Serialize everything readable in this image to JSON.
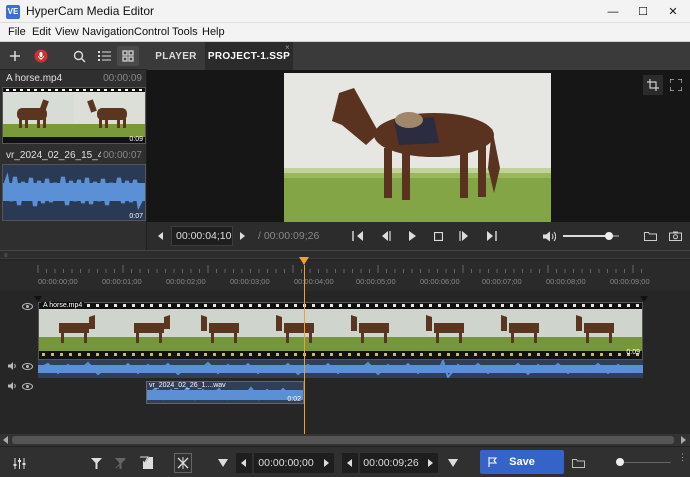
{
  "window": {
    "icon_text": "VE",
    "title": "HyperCam Media Editor",
    "minimize_glyph": "—",
    "maximize_glyph": "☐",
    "close_glyph": "✕"
  },
  "menu": [
    "File",
    "Edit",
    "View",
    "Navigation",
    "Control",
    "Tools",
    "Help"
  ],
  "tabs": [
    {
      "label": "PLAYER",
      "active": false
    },
    {
      "label": "PROJECT-1.SSP",
      "active": true
    }
  ],
  "media_list": [
    {
      "name": "A horse.mp4",
      "duration": "00:00:09",
      "thumb_duration": "0:09"
    },
    {
      "name": "vr_2024_02_26_15_45...",
      "duration": "00:00:07",
      "thumb_duration": "0:07"
    }
  ],
  "player": {
    "current_time": "00:00:04;10",
    "total_time": "/ 00:00:09;26",
    "volume_level": 0.83
  },
  "timeline": {
    "ruler_labels": [
      "00:00:00;00",
      "00:00:01;00",
      "00:00:02;00",
      "00:00:03;00",
      "00:00:04;00",
      "00:00:05;00",
      "00:00:06;00",
      "00:00:07;00",
      "00:00:08;00",
      "00:00:09;00"
    ],
    "video_clip_name": "A horse.mp4",
    "video_clip_duration": "0:09",
    "audio_clip_name": "vr_2024_02_26_1....wav",
    "audio_clip_duration": "0:02",
    "playhead_time_fraction": 0.44
  },
  "bottom": {
    "start_time": "00:00:00;00",
    "end_time": "00:00:09;26",
    "save_label": "Save"
  },
  "colors": {
    "accent": "#3563c8",
    "waveform": "#5b8fd6",
    "playhead": "#f0a030"
  }
}
